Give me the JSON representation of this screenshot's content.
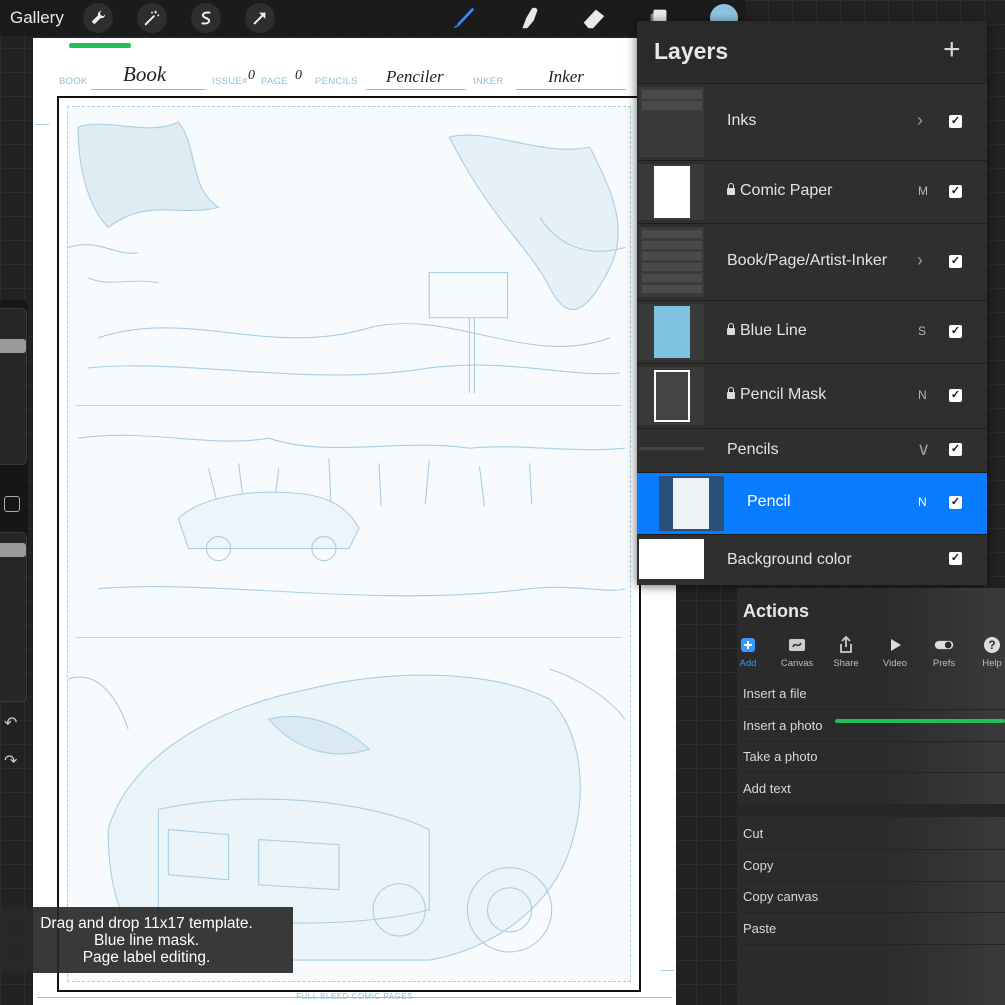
{
  "toolbar": {
    "gallery_label": "Gallery",
    "left_tools": [
      "wrench-icon",
      "magic-wand-icon",
      "selection-icon",
      "transform-icon"
    ],
    "right_tools": [
      "brush-icon",
      "smudge-icon",
      "eraser-icon",
      "layers-icon"
    ],
    "active_color": "#8ec3e0"
  },
  "page": {
    "label_book": "BOOK",
    "value_book": "Book",
    "label_issue": "ISSUE#",
    "value_issue": "0",
    "label_page": "PAGE",
    "value_page": "0",
    "label_pencils": "PENCILS",
    "value_pencils": "Penciler",
    "label_inker": "INKER",
    "value_inker": "Inker",
    "footer": "FULL BLEED COMIC PAGES"
  },
  "caption": {
    "line1": "Drag and drop 11x17 template.",
    "line2": "Blue line mask.",
    "line3": "Page label editing."
  },
  "layers": {
    "title": "Layers",
    "add_label": "+",
    "rows": [
      {
        "name": "Inks",
        "blend": "",
        "chevron": ">",
        "checked": true,
        "locked": false
      },
      {
        "name": "Comic Paper",
        "blend": "M",
        "chevron": "",
        "checked": true,
        "locked": true
      },
      {
        "name": "Book/Page/Artist-Inker",
        "blend": "",
        "chevron": ">",
        "checked": true,
        "locked": false
      },
      {
        "name": "Blue Line",
        "blend": "S",
        "chevron": "",
        "checked": true,
        "locked": true
      },
      {
        "name": "Pencil Mask",
        "blend": "N",
        "chevron": "",
        "checked": true,
        "locked": true
      },
      {
        "name": "Pencils",
        "blend": "",
        "chevron": "v",
        "checked": true,
        "locked": false
      },
      {
        "name": "Pencil",
        "blend": "N",
        "chevron": "",
        "checked": true,
        "locked": false,
        "selected": true
      },
      {
        "name": "Background color",
        "blend": "",
        "chevron": "",
        "checked": true,
        "locked": false
      }
    ],
    "check_glyph": "✓",
    "selected_color": "#0a7cff"
  },
  "actions": {
    "title": "Actions",
    "tabs": [
      "Add",
      "Canvas",
      "Share",
      "Video",
      "Prefs",
      "Help"
    ],
    "active_tab": "Add",
    "items_group1": [
      "Insert a file",
      "Insert a photo",
      "Take a photo",
      "Add text"
    ],
    "items_group2": [
      "Cut",
      "Copy",
      "Copy canvas",
      "Paste"
    ]
  },
  "colors": {
    "bluline": "#8fc0dc",
    "accent_green": "#1fbf5a"
  }
}
